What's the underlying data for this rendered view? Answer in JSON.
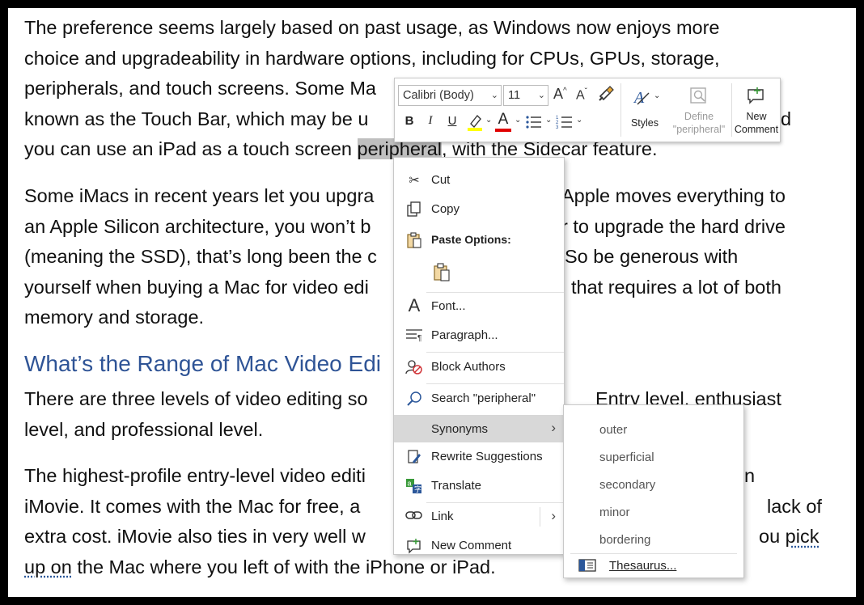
{
  "document": {
    "para1": [
      "The preference seems largely based on past usage, as Windows now enjoys more",
      "choice and upgradeability in hardware options, including for CPUs, GPUs, storage,",
      "peripherals, and touch screens. Some Ma",
      "known as the Touch Bar, which may be u",
      "d",
      "you can use an iPad as a touch screen ",
      "peripheral",
      ", with the Sidecar feature."
    ],
    "para2": [
      "Some iMacs in recent years let you upgra",
      "Apple moves everything to",
      "an Apple Silicon architecture, you won’t b",
      "r to upgrade the hard drive",
      "(meaning the SSD), that’s long been the c",
      "So be generous with",
      "yourself when buying a Mac for video edi",
      "that requires a lot of both",
      "memory and storage."
    ],
    "heading": "What’s the Range of Mac Video Edi",
    "para3": [
      "There are three levels of video editing so",
      "Entry level, enthusiast",
      "level, and professional level."
    ],
    "para4": [
      "The highest-profile entry-level video editi",
      "n",
      "iMovie. It comes with the Mac for free, a",
      "lack of",
      "extra cost. iMovie also ties in very well w",
      "ou ",
      "pick",
      "up on",
      " the Mac where you left of with the iPhone or iPad."
    ]
  },
  "toolbar": {
    "font_name": "Calibri (Body)",
    "font_size": "11",
    "grow_font": "A",
    "shrink_font": "A",
    "bold": "B",
    "italic": "I",
    "underline": "U",
    "font_color_letter": "A",
    "highlight_color": "#ffff00",
    "font_color": "#e00000",
    "styles_label": "Styles",
    "define_label_1": "Define",
    "define_label_2": "\"peripheral\"",
    "new_comment_label_1": "New",
    "new_comment_label_2": "Comment"
  },
  "context_menu": {
    "cut": "Cut",
    "copy": "Copy",
    "paste_options": "Paste Options:",
    "font": "Font...",
    "paragraph": "Paragraph...",
    "block_authors": "Block Authors",
    "search": "Search \"peripheral\"",
    "synonyms": "Synonyms",
    "rewrite": "Rewrite Suggestions",
    "translate": "Translate",
    "link": "Link",
    "new_comment": "New Comment"
  },
  "synonyms_menu": {
    "items": [
      "outer",
      "superficial",
      "secondary",
      "minor",
      "bordering"
    ],
    "thesaurus": "Thesaurus..."
  },
  "colors": {
    "heading": "#2f5496",
    "accent": "#2b579a",
    "hover": "#d8d8d8"
  }
}
